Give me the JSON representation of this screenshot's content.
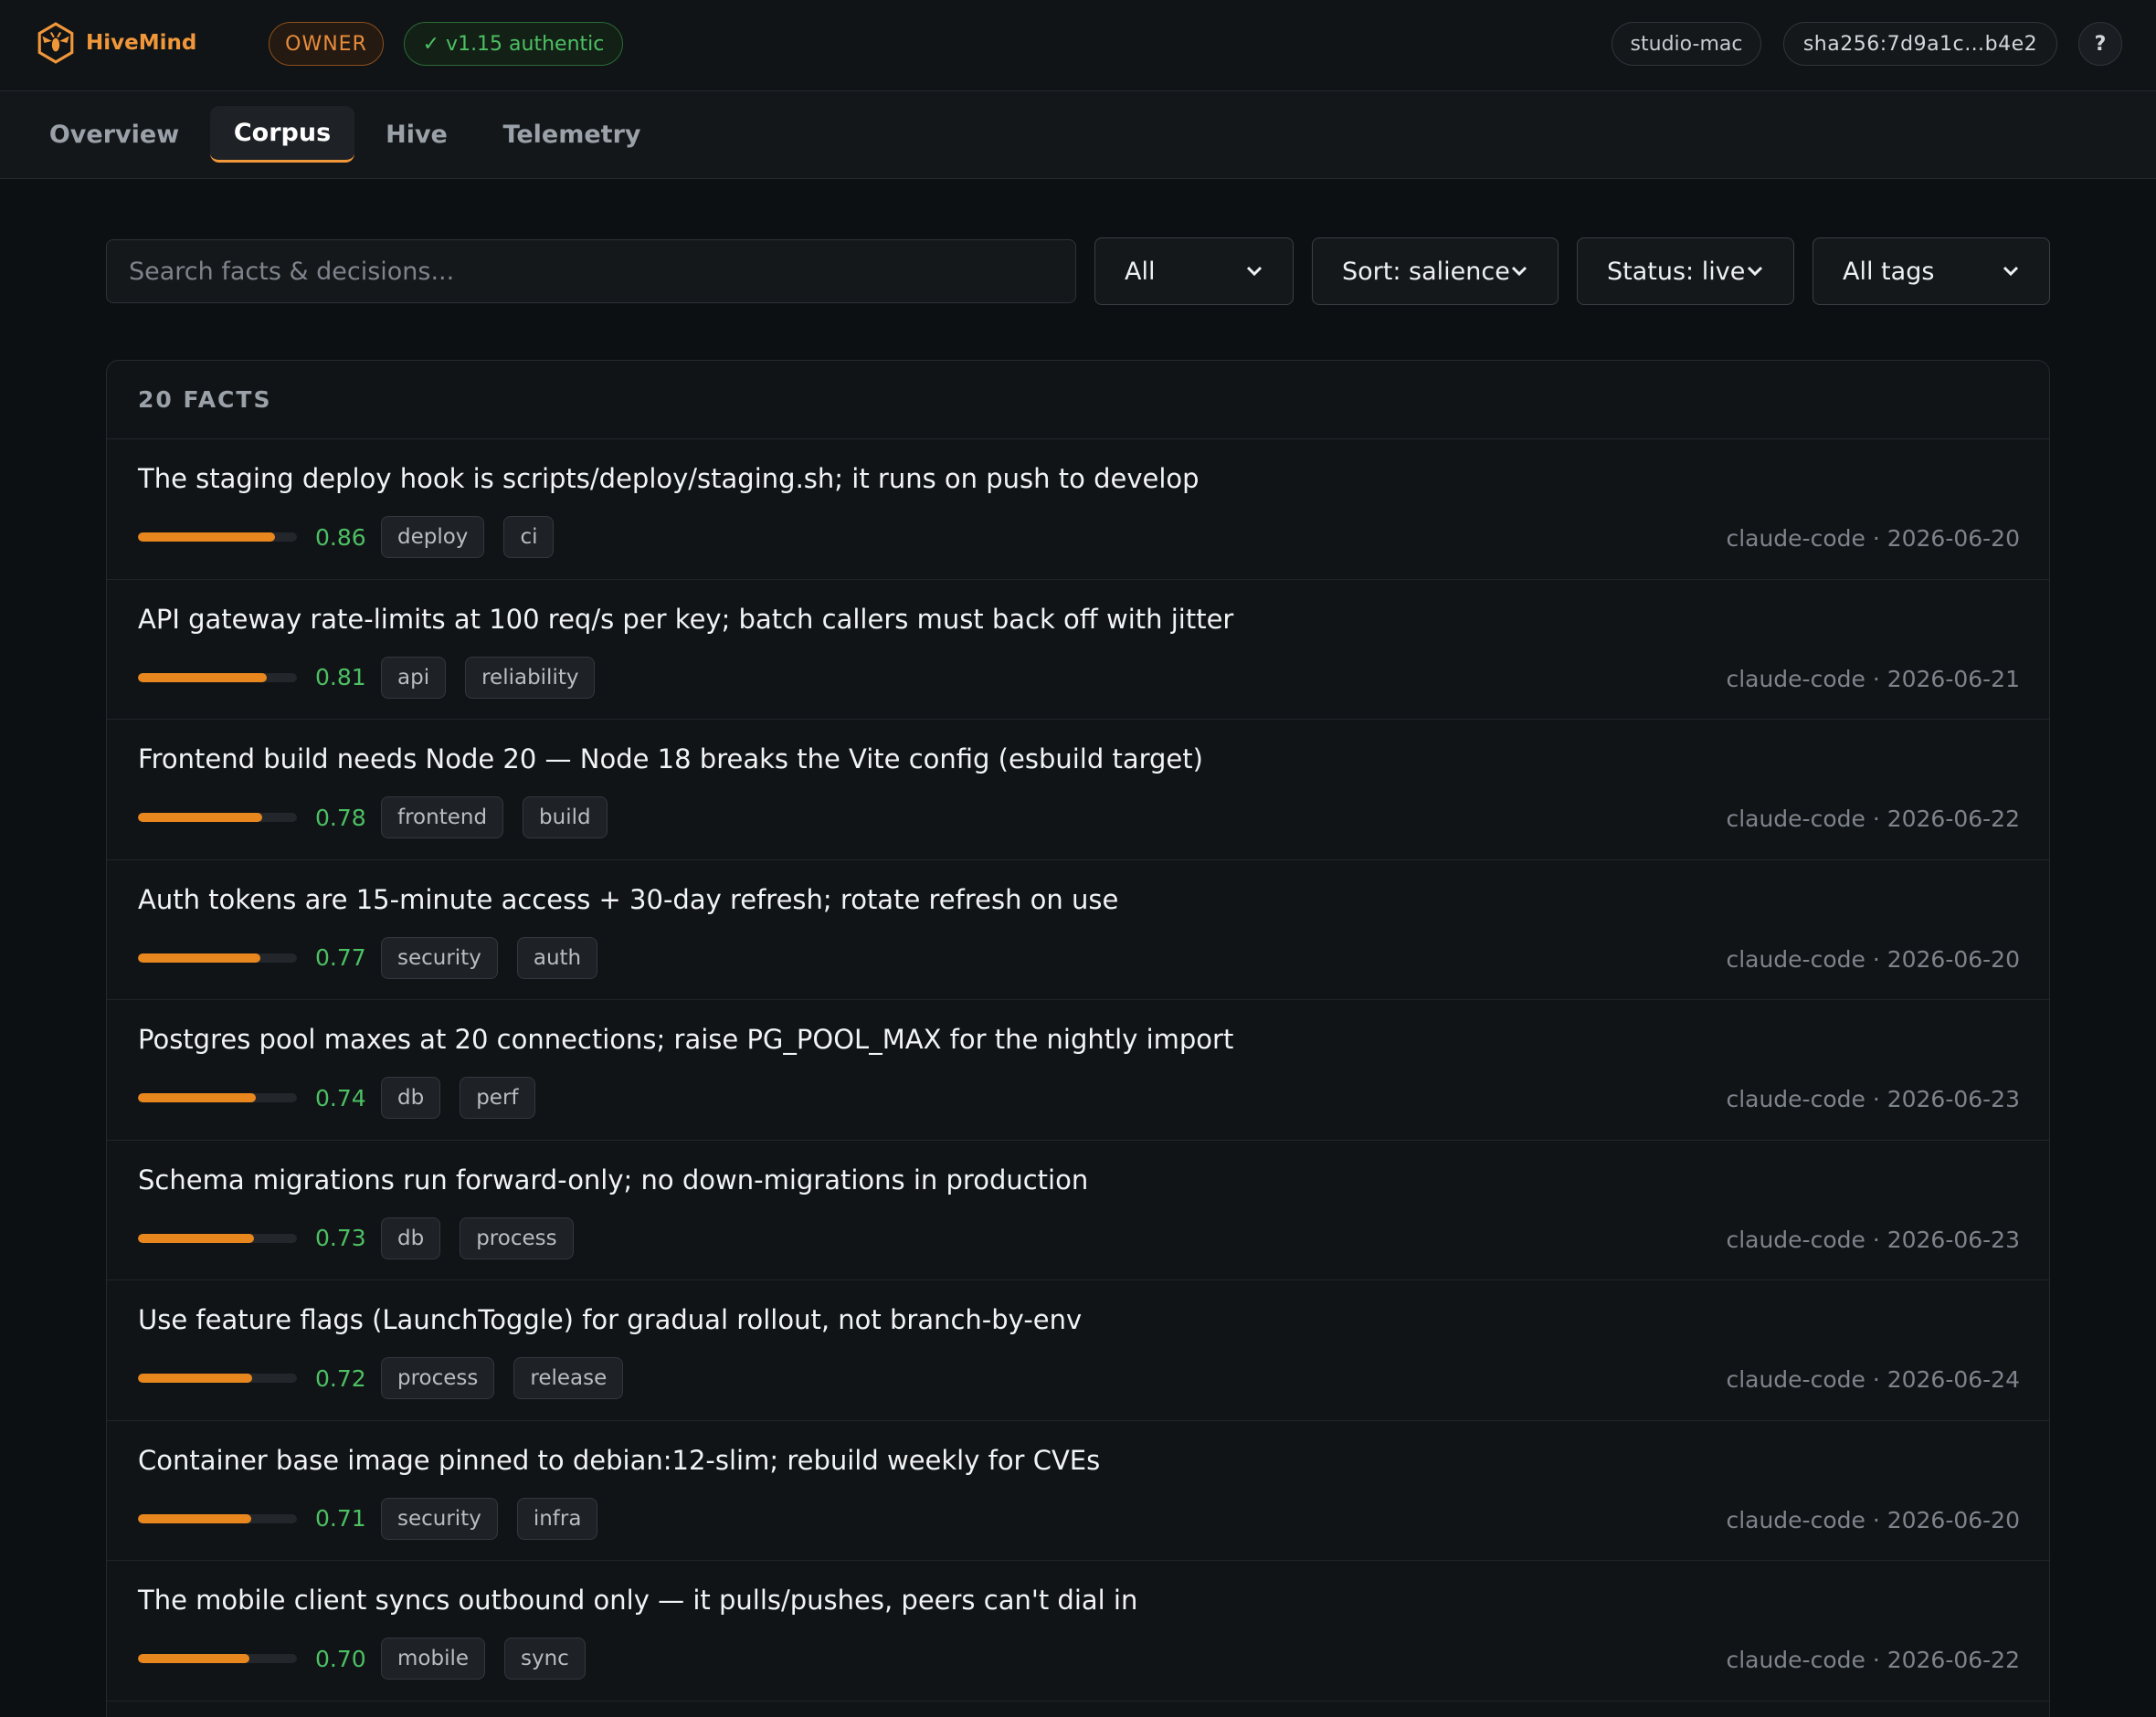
{
  "app": {
    "name": "HiveMind",
    "role_badge": "OWNER",
    "auth_badge": "✓ v1.15 authentic",
    "device": "studio-mac",
    "hash": "sha256:7d9a1c…b4e2",
    "help_label": "?"
  },
  "tabs": [
    {
      "label": "Overview",
      "active": false
    },
    {
      "label": "Corpus",
      "active": true
    },
    {
      "label": "Hive",
      "active": false
    },
    {
      "label": "Telemetry",
      "active": false
    }
  ],
  "filters": {
    "search_placeholder": "Search facts & decisions...",
    "search_value": "",
    "type": "All",
    "sort": "Sort: salience",
    "status": "Status: live",
    "tags": "All tags"
  },
  "facts_header": "20 FACTS",
  "facts": [
    {
      "text": "The staging deploy hook is scripts/deploy/staging.sh; it runs on push to develop",
      "score": "0.86",
      "salience": 0.86,
      "tags": [
        "deploy",
        "ci"
      ],
      "source": "claude-code · 2026-06-20"
    },
    {
      "text": "API gateway rate-limits at 100 req/s per key; batch callers must back off with jitter",
      "score": "0.81",
      "salience": 0.81,
      "tags": [
        "api",
        "reliability"
      ],
      "source": "claude-code · 2026-06-21"
    },
    {
      "text": "Frontend build needs Node 20 — Node 18 breaks the Vite config (esbuild target)",
      "score": "0.78",
      "salience": 0.78,
      "tags": [
        "frontend",
        "build"
      ],
      "source": "claude-code · 2026-06-22"
    },
    {
      "text": "Auth tokens are 15-minute access + 30-day refresh; rotate refresh on use",
      "score": "0.77",
      "salience": 0.77,
      "tags": [
        "security",
        "auth"
      ],
      "source": "claude-code · 2026-06-20"
    },
    {
      "text": "Postgres pool maxes at 20 connections; raise PG_POOL_MAX for the nightly import",
      "score": "0.74",
      "salience": 0.74,
      "tags": [
        "db",
        "perf"
      ],
      "source": "claude-code · 2026-06-23"
    },
    {
      "text": "Schema migrations run forward-only; no down-migrations in production",
      "score": "0.73",
      "salience": 0.73,
      "tags": [
        "db",
        "process"
      ],
      "source": "claude-code · 2026-06-23"
    },
    {
      "text": "Use feature flags (LaunchToggle) for gradual rollout, not branch-by-env",
      "score": "0.72",
      "salience": 0.72,
      "tags": [
        "process",
        "release"
      ],
      "source": "claude-code · 2026-06-24"
    },
    {
      "text": "Container base image pinned to debian:12-slim; rebuild weekly for CVEs",
      "score": "0.71",
      "salience": 0.71,
      "tags": [
        "security",
        "infra"
      ],
      "source": "claude-code · 2026-06-20"
    },
    {
      "text": "The mobile client syncs outbound only — it pulls/pushes, peers can't dial in",
      "score": "0.70",
      "salience": 0.7,
      "tags": [
        "mobile",
        "sync"
      ],
      "source": "claude-code · 2026-06-22"
    }
  ],
  "colors": {
    "accent": "#f0973a",
    "bar_fill": "#e8871e",
    "score": "#4cc063",
    "background": "#0d1013"
  },
  "icons": {
    "logo": "hive-logo-icon",
    "select": "chevron-down-icon"
  }
}
